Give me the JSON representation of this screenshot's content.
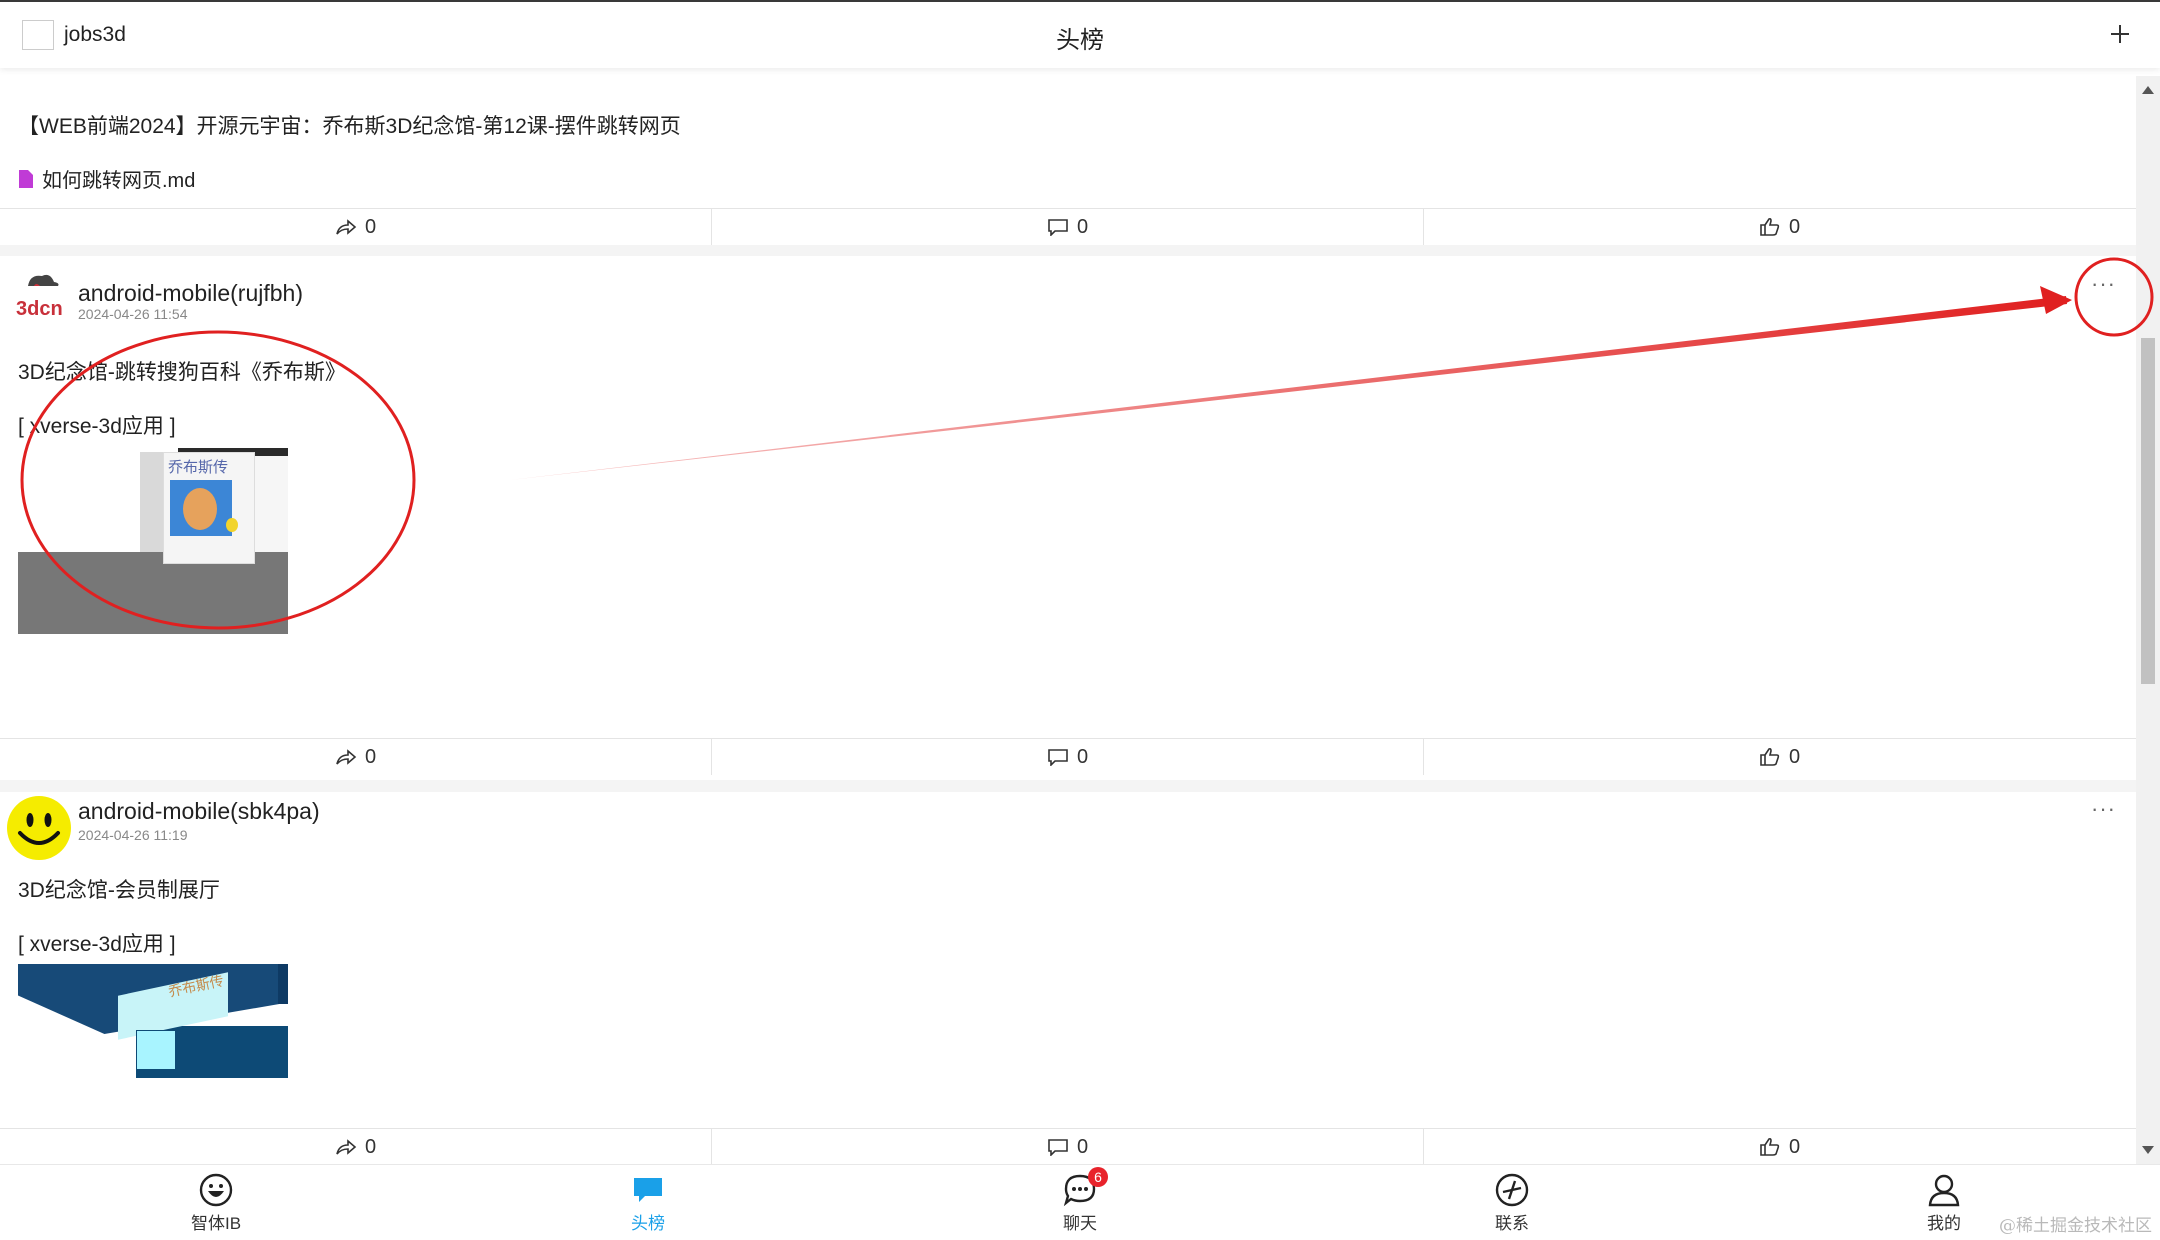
{
  "header": {
    "app_name": "jobs3d",
    "title": "头榜"
  },
  "posts": [
    {
      "text": "【WEB前端2024】开源元宇宙：乔布斯3D纪念馆-第12课-摆件跳转网页",
      "file_name": "如何跳转网页.md",
      "shares": "0",
      "comments": "0",
      "likes": "0"
    },
    {
      "user": "android-mobile(rujfbh)",
      "avatar_label": "3dcn",
      "time": "2024-04-26 11:54",
      "text": "3D纪念馆-跳转搜狗百科《乔布斯》",
      "app_tag": "[ xverse-3d应用 ]",
      "image_caption": "乔布斯传",
      "more": "···",
      "shares": "0",
      "comments": "0",
      "likes": "0"
    },
    {
      "user": "android-mobile(sbk4pa)",
      "time": "2024-04-26 11:19",
      "text": "3D纪念馆-会员制展厅",
      "app_tag": "[ xverse-3d应用 ]",
      "image_caption": "乔布斯传",
      "more": "···",
      "shares": "0",
      "comments": "0",
      "likes": "0"
    }
  ],
  "tabbar": {
    "items": [
      {
        "label": "智体IB",
        "icon": "smiley-icon"
      },
      {
        "label": "头榜",
        "icon": "chat-bubble-icon",
        "active": true
      },
      {
        "label": "聊天",
        "icon": "message-icon",
        "badge": "6"
      },
      {
        "label": "联系",
        "icon": "compass-icon"
      },
      {
        "label": "我的",
        "icon": "person-icon"
      }
    ]
  },
  "watermark": "@稀土掘金技术社区",
  "colors": {
    "accent": "#1aa0e8",
    "badge": "#e8232b",
    "annotation": "#e02020"
  }
}
